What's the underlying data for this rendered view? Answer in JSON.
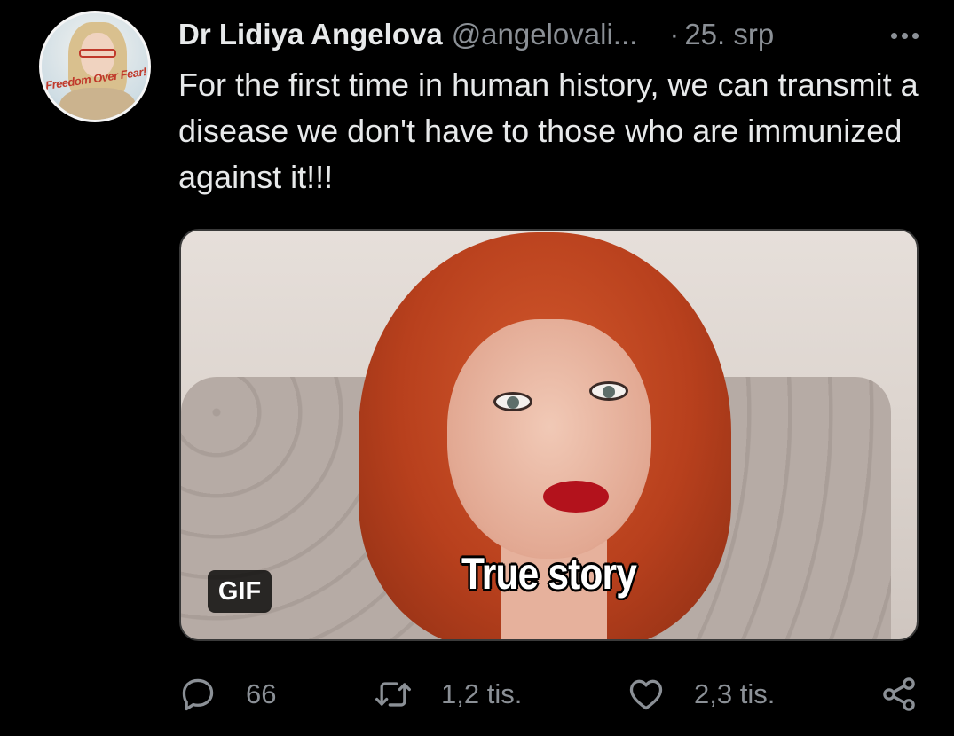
{
  "tweet": {
    "author_name": "Dr Lidiya Angelova",
    "handle": "@angelovali...",
    "separator": "·",
    "date": "25. srp",
    "text": "For the first time in human history, we can transmit a disease we don't have to those who are immunized against it!!!",
    "avatar_banner": "Freedom Over Fear!",
    "media": {
      "caption": "True story",
      "badge": "GIF"
    },
    "actions": {
      "replies": "66",
      "retweets": "1,2 tis.",
      "likes": "2,3 tis."
    }
  },
  "icons": [
    "more-icon",
    "reply-icon",
    "retweet-icon",
    "like-icon",
    "share-icon"
  ],
  "colors": {
    "background": "#000000",
    "primary_text": "#e7e9ea",
    "secondary_text": "#8b9096"
  }
}
